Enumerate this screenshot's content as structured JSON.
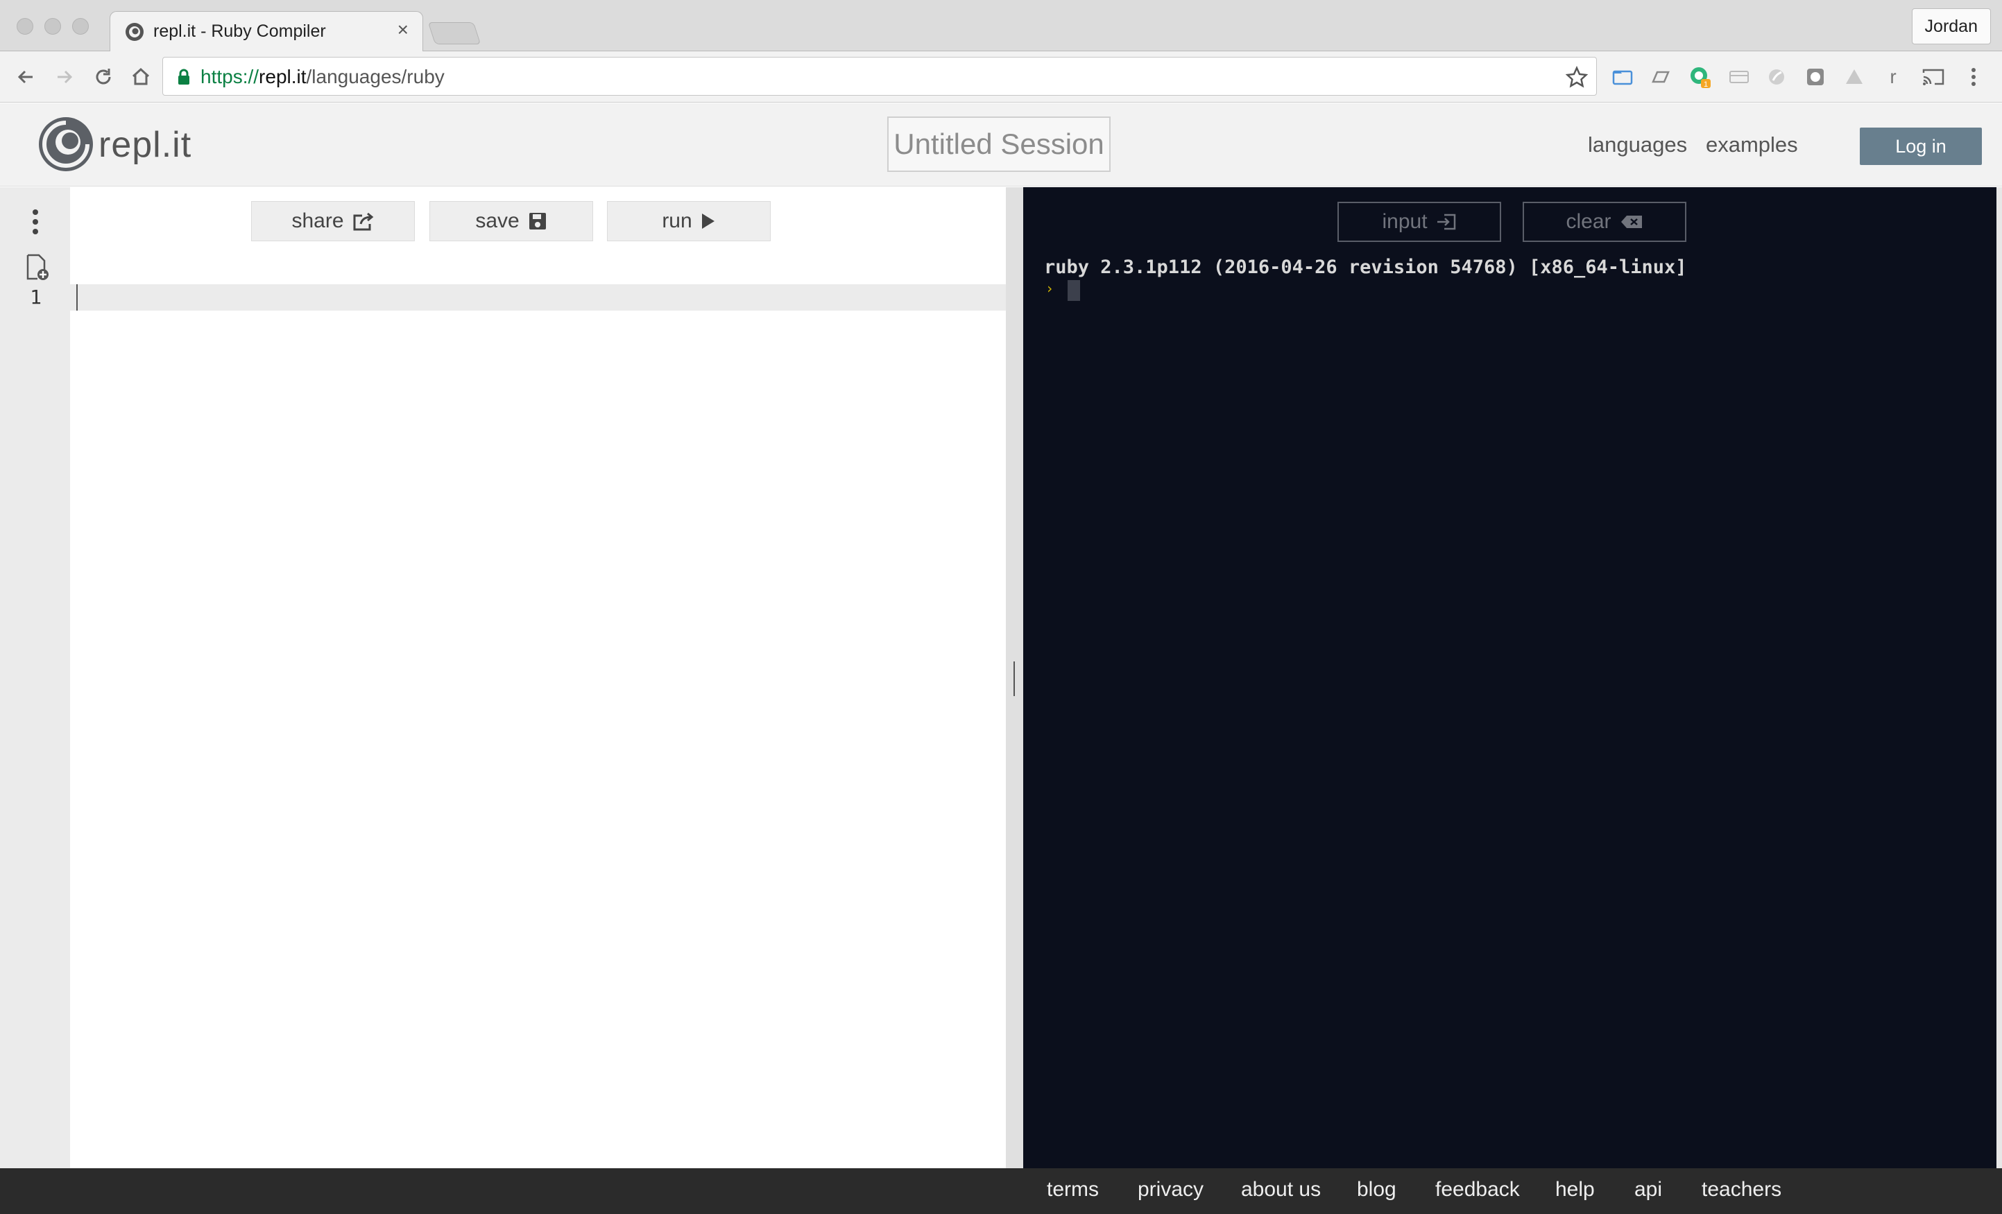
{
  "browser": {
    "tab_title": "repl.it - Ruby Compiler",
    "tab_close": "×",
    "profile_name": "Jordan",
    "url_scheme": "https://",
    "url_host": "repl.it",
    "url_path": "/languages/ruby",
    "extensions": [
      "folder-icon",
      "drive-icon",
      "grammarly-icon",
      "card-icon",
      "feather-icon",
      "box-icon",
      "cloud-icon",
      "r-icon",
      "cast-icon"
    ],
    "ext_badge": "1",
    "ext_r_label": "r"
  },
  "header": {
    "brand_text": "repl.it",
    "session_title": "Untitled Session",
    "nav": [
      "languages",
      "examples"
    ],
    "login_label": "Log in",
    "login_color": "#687f8e"
  },
  "editor": {
    "buttons": [
      {
        "label": "share",
        "icon": "share-icon"
      },
      {
        "label": "save",
        "icon": "floppy-icon"
      },
      {
        "label": "run",
        "icon": "play-icon"
      }
    ],
    "line_number": "1"
  },
  "console": {
    "buttons": [
      {
        "label": "input",
        "icon": "input-icon"
      },
      {
        "label": "clear",
        "icon": "backspace-icon"
      }
    ],
    "version_line": "ruby 2.3.1p112 (2016-04-26 revision 54768) [x86_64-linux]",
    "prompt_symbol": "›",
    "background_color": "#0b0f1c",
    "prompt_color": "#d2b600"
  },
  "footer": {
    "links": [
      "terms",
      "privacy",
      "about us",
      "blog",
      "feedback",
      "help",
      "api",
      "teachers"
    ]
  }
}
